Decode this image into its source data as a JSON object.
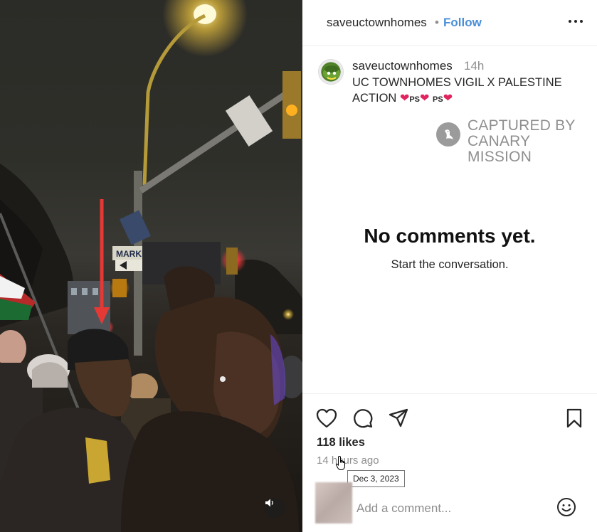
{
  "post": {
    "header_username": "saveuctownhomes",
    "separator": "•",
    "follow_label": "Follow"
  },
  "caption": {
    "username": "saveuctownhomes",
    "time": "14h",
    "line1": "UC TOWNHOMES VIGIL X PALESTINE",
    "line2_text": "ACTION",
    "ps1": "PS",
    "ps2": "PS",
    "heart": "❤"
  },
  "watermark": {
    "line1": "CAPTURED BY",
    "line2": "CANARY MISSION"
  },
  "comments": {
    "empty_title": "No comments yet.",
    "empty_subtitle": "Start the conversation."
  },
  "footer": {
    "likes": "118 likes",
    "time_ago": "14 hours ago",
    "tooltip_date": "Dec 3, 2023",
    "comment_placeholder": "Add a comment..."
  },
  "media": {
    "street_sign": "MARKET ST"
  },
  "icons": {
    "like": "heart-outline-icon",
    "comment": "comment-bubble-icon",
    "share": "paper-plane-icon",
    "save": "bookmark-icon",
    "more": "more-horizontal-icon",
    "emoji": "smiley-icon",
    "audio": "speaker-icon"
  },
  "colors": {
    "follow": "#4a8fd9",
    "heart": "#e0245e",
    "arrow": "#e53935"
  }
}
